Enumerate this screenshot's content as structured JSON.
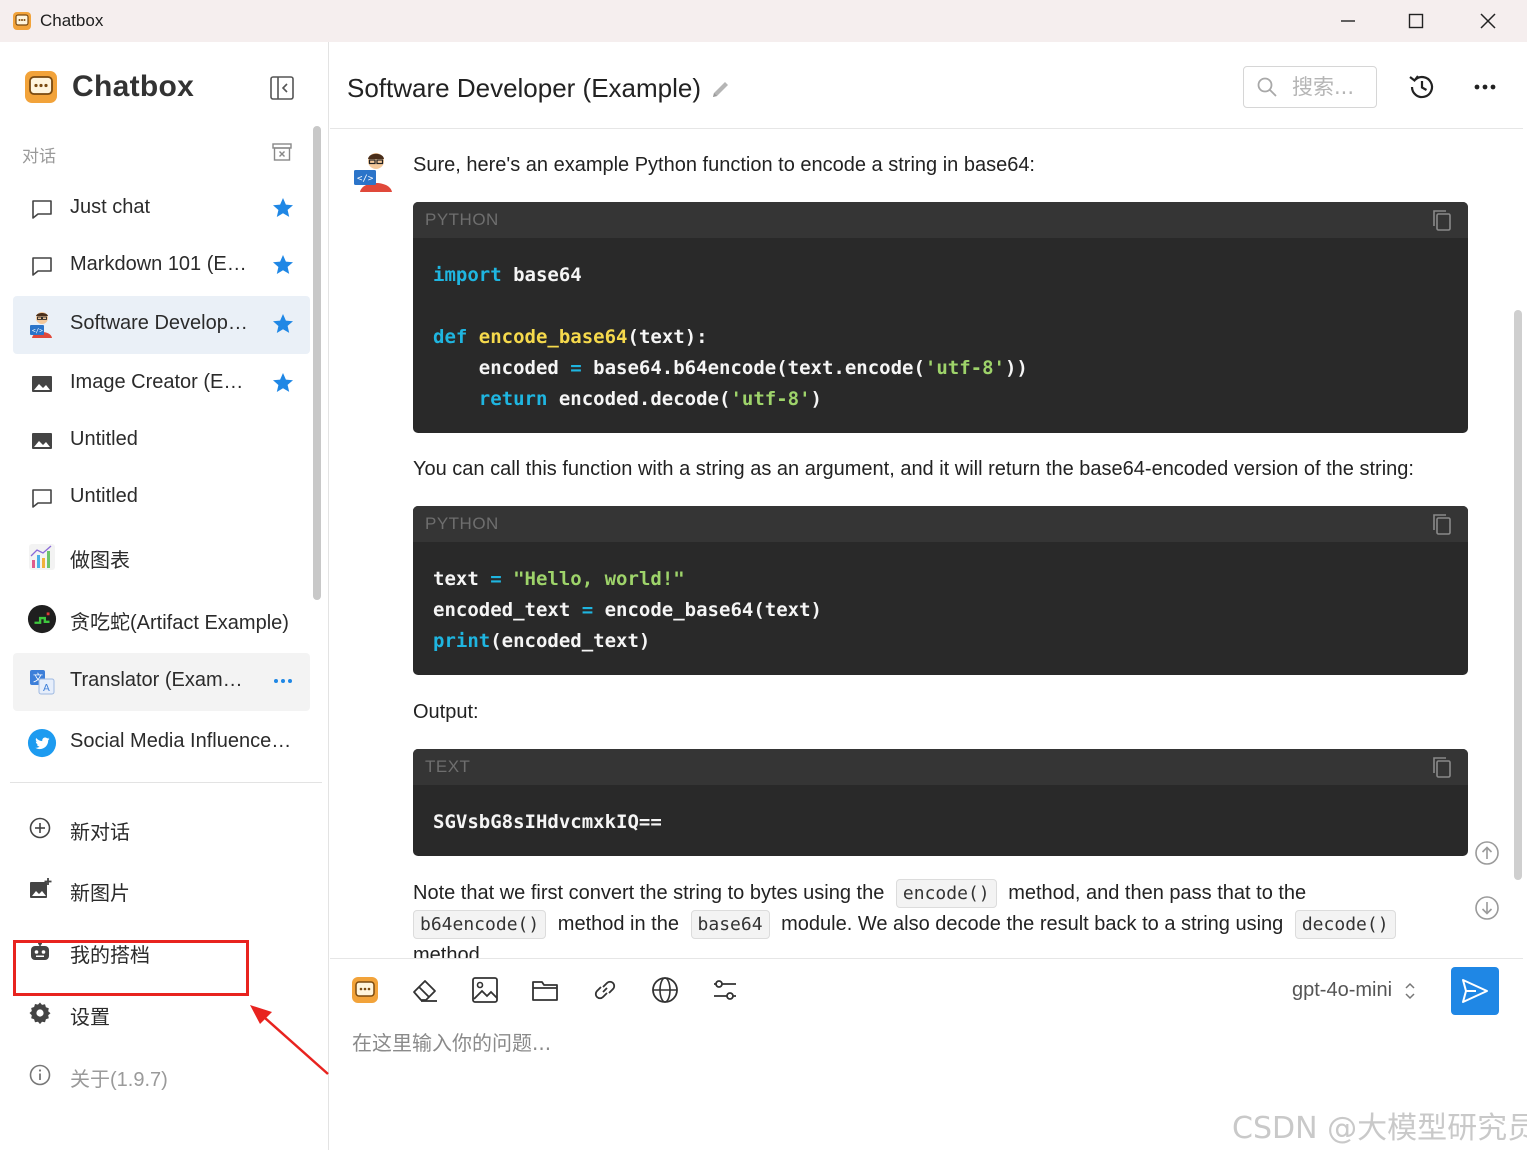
{
  "window": {
    "title": "Chatbox",
    "controls": [
      "minimize",
      "maximize",
      "close"
    ]
  },
  "sidebar": {
    "brand": "Chatbox",
    "section_label": "对话",
    "conversations": [
      {
        "label": "Just chat",
        "icon": "chat-bubble-icon",
        "starred": true
      },
      {
        "label": "Markdown 101 (E…",
        "icon": "chat-bubble-icon",
        "starred": true
      },
      {
        "label": "Software Develop…",
        "icon": "developer-avatar-icon",
        "starred": true,
        "active": true
      },
      {
        "label": "Image Creator (E…",
        "icon": "image-icon",
        "starred": true
      },
      {
        "label": "Untitled",
        "icon": "image-icon",
        "starred": false
      },
      {
        "label": "Untitled",
        "icon": "chat-bubble-icon",
        "starred": false
      },
      {
        "label": "做图表",
        "icon": "chart-avatar-icon",
        "starred": false
      },
      {
        "label": "贪吃蛇(Artifact Example)",
        "icon": "snake-avatar-icon",
        "starred": false
      },
      {
        "label": "Translator (Exam…",
        "icon": "translate-avatar-icon",
        "starred": false,
        "hover": true
      },
      {
        "label": "Social Media Influence…",
        "icon": "twitter-avatar-icon",
        "starred": false
      }
    ],
    "menu": {
      "new_chat": "新对话",
      "new_image": "新图片",
      "my_partners": "我的搭档",
      "settings": "设置",
      "about": "关于(1.9.7)"
    }
  },
  "header": {
    "title": "Software Developer (Example)",
    "search_placeholder": "搜索..."
  },
  "messages": {
    "intro": "Sure, here's an example Python function to encode a string in base64:",
    "code1_lang": "PYTHON",
    "explain": "You can call this function with a string as an argument, and it will return the base64-encoded version of the string:",
    "code2_lang": "PYTHON",
    "output_label": "Output:",
    "code3_lang": "TEXT",
    "code3": "SGVsbG8sIHdvcmxkIQ==",
    "note_part1": "Note that we first convert the string to bytes using the",
    "note_code1": "encode()",
    "note_part2": "method, and then pass that to the",
    "note_code2": "b64encode()",
    "note_part3": "method in the",
    "note_code3": "base64",
    "note_part4": "module. We also decode the result back to a string using",
    "note_code4": "decode()",
    "note_part5": "method."
  },
  "composer": {
    "model": "gpt-4o-mini",
    "placeholder": "在这里输入你的问题..."
  },
  "watermark": "CSDN @大模型研究员",
  "colors": {
    "accent": "#1f87e5",
    "titlebar": "#f5eeee",
    "code_bg": "#292929",
    "highlight": "#e8231f"
  }
}
